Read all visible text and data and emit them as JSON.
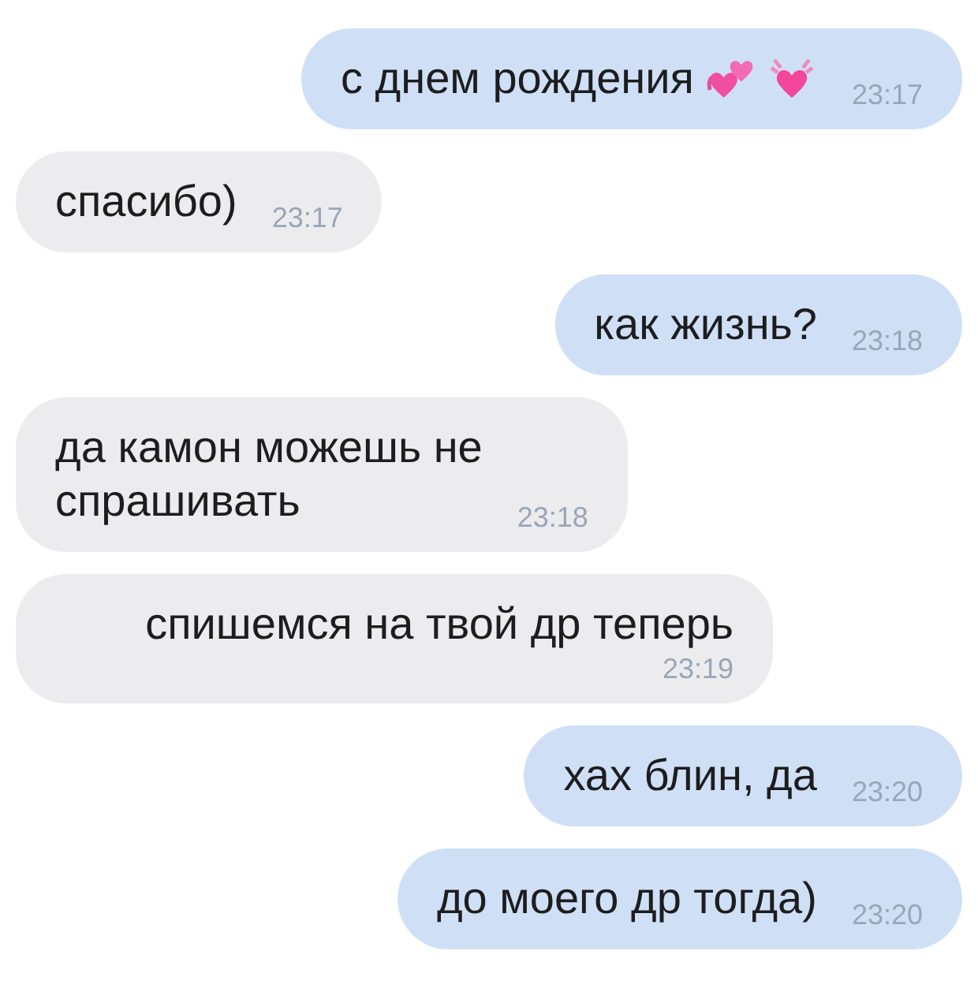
{
  "messages": [
    {
      "kind": "outgoing",
      "lines": [
        "с днем рождения"
      ],
      "emoji": [
        {
          "kind": "two-hearts"
        },
        {
          "kind": "growing-heart"
        }
      ],
      "time": "23:17"
    },
    {
      "kind": "incoming",
      "lines": [
        "спасибо)"
      ],
      "time": "23:17"
    },
    {
      "kind": "outgoing",
      "lines": [
        "как жизнь?"
      ],
      "time": "23:18"
    },
    {
      "kind": "incoming",
      "lines": [
        "да камон можешь не",
        "спрашивать"
      ],
      "time": "23:18"
    },
    {
      "kind": "incoming",
      "lines": [
        "спишемся на твой др теперь"
      ],
      "time": "23:19"
    },
    {
      "kind": "outgoing",
      "lines": [
        "хах блин, да"
      ],
      "time": "23:20"
    },
    {
      "kind": "outgoing",
      "lines": [
        "до моего др тогда)"
      ],
      "time": "23:20"
    }
  ]
}
